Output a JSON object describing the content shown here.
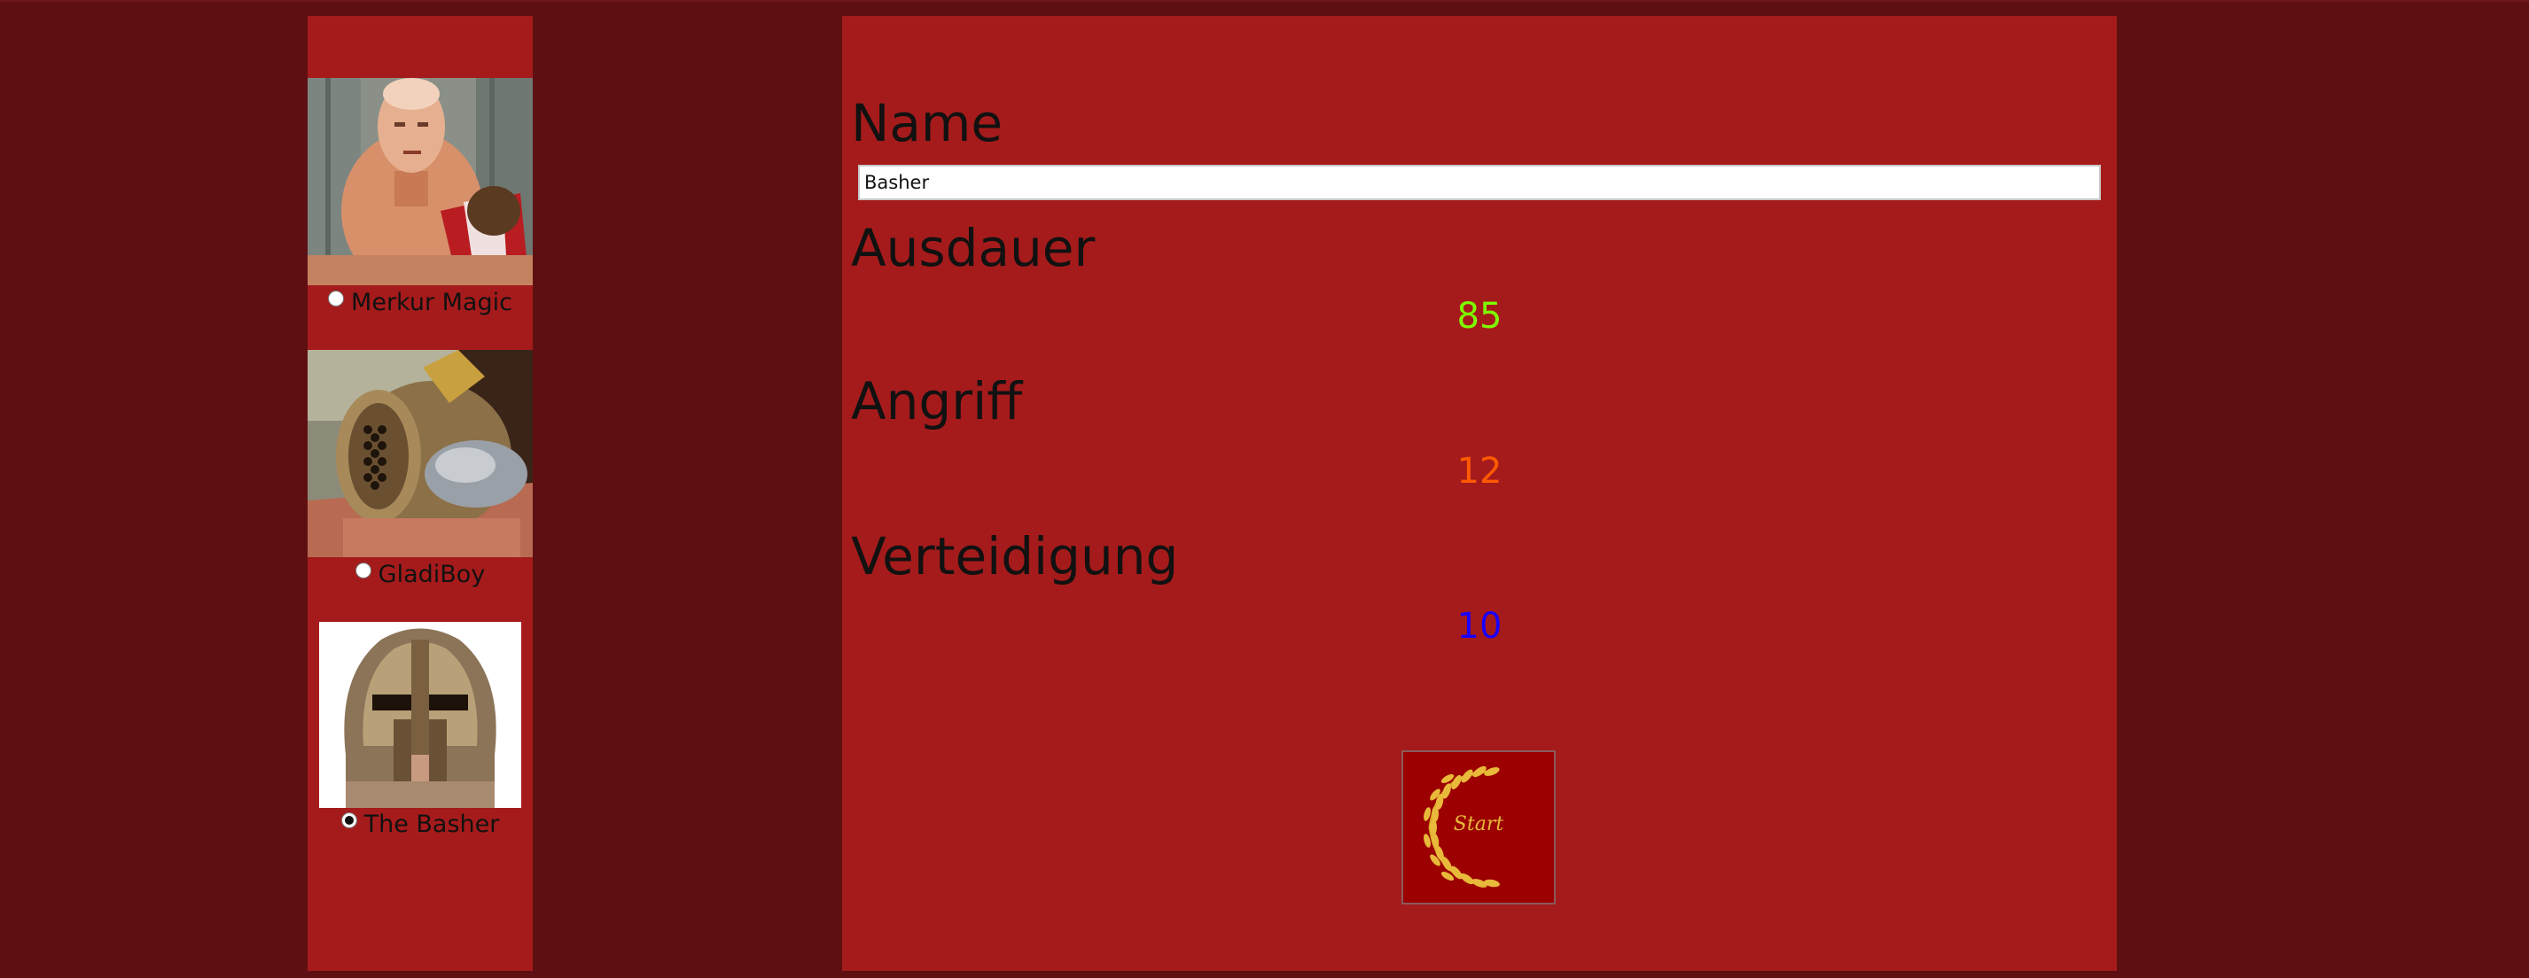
{
  "colors": {
    "background": "#5e0f12",
    "panel": "#a51b1b",
    "ausdauer_value": "#7dff00",
    "angriff_value": "#ff5a00",
    "verteidigung_value": "#1a00ff",
    "start_gold": "#e8b93a"
  },
  "sidebar": {
    "fighters": [
      {
        "label": "Merkur Magic",
        "selected": false,
        "icon": "bald-gladiator-portrait"
      },
      {
        "label": "GladiBoy",
        "selected": false,
        "icon": "gladiator-helmet-portrait"
      },
      {
        "label": "The Basher",
        "selected": true,
        "icon": "spartan-helmet-portrait"
      }
    ]
  },
  "form": {
    "name_heading": "Name",
    "name_value": "Basher",
    "ausdauer_heading": "Ausdauer",
    "ausdauer_value": "85",
    "angriff_heading": "Angriff",
    "angriff_value": "12",
    "verteidigung_heading": "Verteidigung",
    "verteidigung_value": "10",
    "start_label": "Start",
    "start_icon": "laurel-wreath-icon"
  }
}
